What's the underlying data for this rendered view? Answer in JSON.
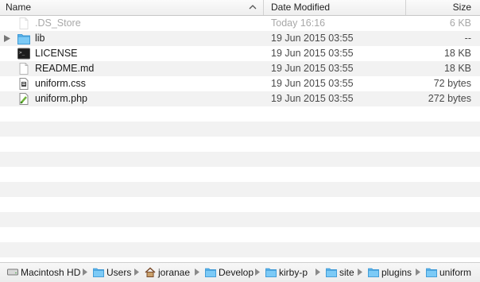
{
  "columns": {
    "name": "Name",
    "date": "Date Modified",
    "size": "Size"
  },
  "files": [
    {
      "name": ".DS_Store",
      "date": "Today 16:16",
      "size": "6 KB",
      "icon": "document-icon",
      "dimmed": true
    },
    {
      "name": "lib",
      "date": "19 Jun 2015 03:55",
      "size": "--",
      "icon": "folder-icon",
      "expandable": true
    },
    {
      "name": "LICENSE",
      "date": "19 Jun 2015 03:55",
      "size": "18 KB",
      "icon": "terminal-icon"
    },
    {
      "name": "README.md",
      "date": "19 Jun 2015 03:55",
      "size": "18 KB",
      "icon": "document-icon"
    },
    {
      "name": "uniform.css",
      "date": "19 Jun 2015 03:55",
      "size": "72 bytes",
      "icon": "css-file-icon"
    },
    {
      "name": "uniform.php",
      "date": "19 Jun 2015 03:55",
      "size": "272 bytes",
      "icon": "php-file-icon"
    }
  ],
  "path": [
    {
      "label": "Macintosh HD",
      "icon": "harddisk-icon"
    },
    {
      "label": "Users",
      "icon": "folder-icon"
    },
    {
      "label": "joranae",
      "icon": "home-icon"
    },
    {
      "label": "Develop",
      "icon": "folder-icon"
    },
    {
      "label": "kirby-p",
      "icon": "folder-icon"
    },
    {
      "label": "site",
      "icon": "folder-icon"
    },
    {
      "label": "plugins",
      "icon": "folder-icon"
    },
    {
      "label": "uniform",
      "icon": "folder-icon"
    }
  ],
  "colors": {
    "folder": "#5ab4ec",
    "alt_row": "#f2f2f2",
    "dim_text": "#a8a8a8"
  }
}
